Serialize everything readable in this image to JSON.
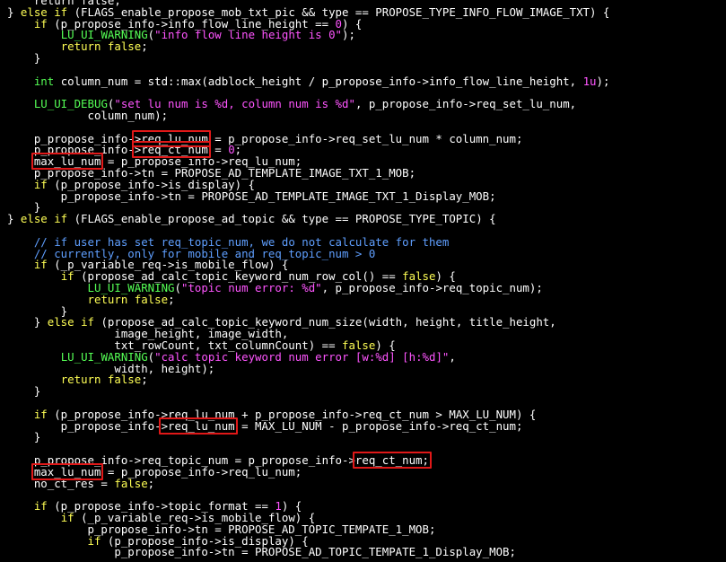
{
  "window": {
    "kind": "code-editor",
    "background": "#000000"
  },
  "theme": {
    "default": "#ffffff",
    "kw": "#ffff55",
    "fn": "#55ff55",
    "str": "#ff55ff",
    "num": "#ff55ff",
    "cm": "#5f9fff",
    "highlight_box": "#e01818"
  },
  "code": [
    [
      [
        "",
        "    return false;"
      ]
    ],
    [
      [
        "",
        "} "
      ],
      [
        "kw",
        "else if"
      ],
      [
        "",
        " (FLAGS_enable_propose_mob_txt_pic && type == PROPOSE_TYPE_INFO_FLOW_IMAGE_TXT) {"
      ]
    ],
    [
      [
        "",
        "    "
      ],
      [
        "kw",
        "if"
      ],
      [
        "",
        " (p_propose_info->info_flow_line_height == "
      ],
      [
        "num",
        "0"
      ],
      [
        "",
        ") {"
      ]
    ],
    [
      [
        "",
        "        "
      ],
      [
        "fn",
        "LU_UI_WARNING"
      ],
      [
        "",
        "("
      ],
      [
        "str",
        "\"info flow line height is 0\""
      ],
      [
        "",
        ");"
      ]
    ],
    [
      [
        "",
        "        "
      ],
      [
        "kw",
        "return false"
      ],
      [
        "",
        ";"
      ]
    ],
    [
      [
        "",
        "    }"
      ]
    ],
    [
      [
        "",
        ""
      ]
    ],
    [
      [
        "",
        "    "
      ],
      [
        "fn",
        "int"
      ],
      [
        "",
        " column_num = std::max(adblock_height / p_propose_info->info_flow_line_height, "
      ],
      [
        "num",
        "1u"
      ],
      [
        "",
        ");"
      ]
    ],
    [
      [
        "",
        ""
      ]
    ],
    [
      [
        "",
        "    "
      ],
      [
        "fn",
        "LU_UI_DEBUG"
      ],
      [
        "",
        "("
      ],
      [
        "str",
        "\"set lu num is %d, column num is %d\""
      ],
      [
        "",
        ", p_propose_info->req_set_lu_num,"
      ]
    ],
    [
      [
        "",
        "            column_num);"
      ]
    ],
    [
      [
        "",
        ""
      ]
    ],
    [
      [
        "",
        "    p_propose_info->req_lu_num = p_propose_info->req_set_lu_num * column_num;"
      ]
    ],
    [
      [
        "",
        "    p_propose_info->req_ct_num = "
      ],
      [
        "num",
        "0"
      ],
      [
        "",
        ";"
      ]
    ],
    [
      [
        "",
        "    max_lu_num = p_propose_info->req_lu_num;"
      ]
    ],
    [
      [
        "",
        "    p_propose_info->tn = PROPOSE_AD_TEMPLATE_IMAGE_TXT_1_MOB;"
      ]
    ],
    [
      [
        "",
        "    "
      ],
      [
        "kw",
        "if"
      ],
      [
        "",
        " (p_propose_info->is_display) {"
      ]
    ],
    [
      [
        "",
        "        p_propose_info->tn = PROPOSE_AD_TEMPLATE_IMAGE_TXT_1_Display_MOB;"
      ]
    ],
    [
      [
        "",
        "    }"
      ]
    ],
    [
      [
        "",
        "} "
      ],
      [
        "kw",
        "else if"
      ],
      [
        "",
        " (FLAGS_enable_propose_ad_topic && type == PROPOSE_TYPE_TOPIC) {"
      ]
    ],
    [
      [
        "",
        ""
      ]
    ],
    [
      [
        "",
        "    "
      ],
      [
        "cm",
        "// if user has set req_topic_num, we do not calculate for them"
      ]
    ],
    [
      [
        "",
        "    "
      ],
      [
        "cm",
        "// currently, only for mobile and req_topic_num > 0"
      ]
    ],
    [
      [
        "",
        "    "
      ],
      [
        "kw",
        "if"
      ],
      [
        "",
        " (_p_variable_req->is_mobile_flow) {"
      ]
    ],
    [
      [
        "",
        "        "
      ],
      [
        "kw",
        "if"
      ],
      [
        "",
        " (propose_ad_calc_topic_keyword_num_row_col() == "
      ],
      [
        "kw",
        "false"
      ],
      [
        "",
        ") {"
      ]
    ],
    [
      [
        "",
        "            "
      ],
      [
        "fn",
        "LU_UI_WARNING"
      ],
      [
        "",
        "("
      ],
      [
        "str",
        "\"topic num error: %d\""
      ],
      [
        "",
        ", p_propose_info->req_topic_num);"
      ]
    ],
    [
      [
        "",
        "            "
      ],
      [
        "kw",
        "return false"
      ],
      [
        "",
        ";"
      ]
    ],
    [
      [
        "",
        "        }"
      ]
    ],
    [
      [
        "",
        "    } "
      ],
      [
        "kw",
        "else if"
      ],
      [
        "",
        " (propose_ad_calc_topic_keyword_num_size(width, height, title_height,"
      ]
    ],
    [
      [
        "",
        "                image_height, image_width,"
      ]
    ],
    [
      [
        "",
        "                txt_rowCount, txt_columnCount) == "
      ],
      [
        "kw",
        "false"
      ],
      [
        "",
        ") {"
      ]
    ],
    [
      [
        "",
        "        "
      ],
      [
        "fn",
        "LU_UI_WARNING"
      ],
      [
        "",
        "("
      ],
      [
        "str",
        "\"calc topic keyword num error [w:%d] [h:%d]\""
      ],
      [
        "",
        ","
      ]
    ],
    [
      [
        "",
        "                width, height);"
      ]
    ],
    [
      [
        "",
        "        "
      ],
      [
        "kw",
        "return false"
      ],
      [
        "",
        ";"
      ]
    ],
    [
      [
        "",
        "    }"
      ]
    ],
    [
      [
        "",
        ""
      ]
    ],
    [
      [
        "",
        "    "
      ],
      [
        "kw",
        "if"
      ],
      [
        "",
        " (p_propose_info->req_lu_num + p_propose_info->req_ct_num > MAX_LU_NUM) {"
      ]
    ],
    [
      [
        "",
        "        p_propose_info->req_lu_num = MAX_LU_NUM - p_propose_info->req_ct_num;"
      ]
    ],
    [
      [
        "",
        "    }"
      ]
    ],
    [
      [
        "",
        ""
      ]
    ],
    [
      [
        "",
        "    p_propose_info->req_topic_num = p_propose_info->req_ct_num;"
      ]
    ],
    [
      [
        "",
        "    max_lu_num = p_propose_info->req_lu_num;"
      ]
    ],
    [
      [
        "",
        "    no_ct_res = "
      ],
      [
        "kw",
        "false"
      ],
      [
        "",
        ";"
      ]
    ],
    [
      [
        "",
        ""
      ]
    ],
    [
      [
        "",
        "    "
      ],
      [
        "kw",
        "if"
      ],
      [
        "",
        " (p_propose_info->topic_format == "
      ],
      [
        "num",
        "1"
      ],
      [
        "",
        ") {"
      ]
    ],
    [
      [
        "",
        "        "
      ],
      [
        "kw",
        "if"
      ],
      [
        "",
        " (_p_variable_req->is_mobile_flow) {"
      ]
    ],
    [
      [
        "",
        "            p_propose_info->tn = PROPOSE_AD_TOPIC_TEMPATE_1_MOB;"
      ]
    ],
    [
      [
        "",
        "            "
      ],
      [
        "kw",
        "if"
      ],
      [
        "",
        " (p_propose_info->is_display) {"
      ]
    ],
    [
      [
        "",
        "                p_propose_info->tn = PROPOSE_AD_TOPIC_TEMPATE_1_Display_MOB;"
      ]
    ]
  ],
  "highlight_boxes": [
    {
      "line": 12,
      "text": ">req_lu_num"
    },
    {
      "line": 13,
      "text": ">req_ct_num"
    },
    {
      "line": 14,
      "text": "max_lu_num"
    },
    {
      "line": 37,
      "text": ">req_lu_num"
    },
    {
      "line": 40,
      "text": "req_ct_num;"
    },
    {
      "line": 41,
      "text": "max_lu_num"
    }
  ]
}
